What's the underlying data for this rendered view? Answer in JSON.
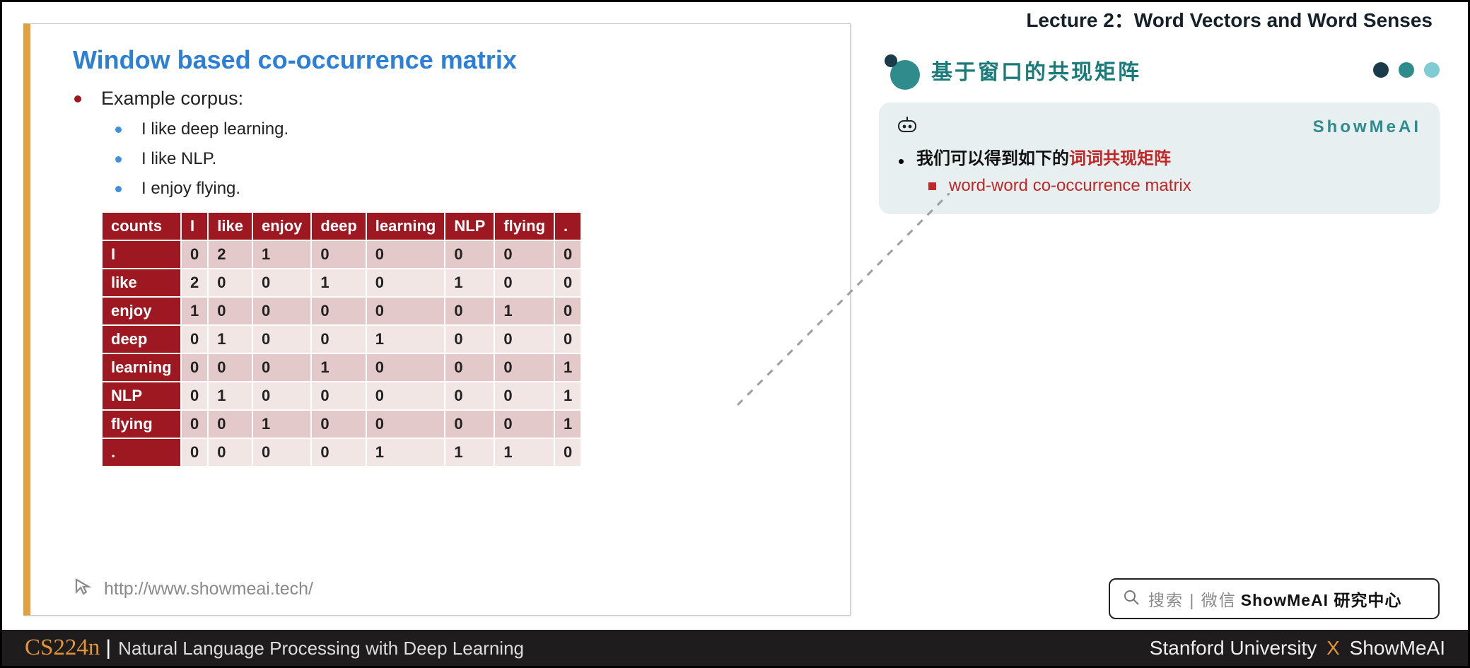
{
  "header": {
    "lecture_title": "Lecture 2：Word Vectors and Word Senses"
  },
  "slide": {
    "title": "Window based co-occurrence matrix",
    "bullet_main": "Example corpus:",
    "examples": [
      "I like deep learning.",
      "I like NLP.",
      "I enjoy flying."
    ],
    "footer_url": "http://www.showmeai.tech/"
  },
  "table": {
    "corner": "counts",
    "cols": [
      "I",
      "like",
      "enjoy",
      "deep",
      "learning",
      "NLP",
      "flying",
      "."
    ],
    "rows": [
      {
        "label": "I",
        "vals": [
          0,
          2,
          1,
          0,
          0,
          0,
          0,
          0
        ]
      },
      {
        "label": "like",
        "vals": [
          2,
          0,
          0,
          1,
          0,
          1,
          0,
          0
        ]
      },
      {
        "label": "enjoy",
        "vals": [
          1,
          0,
          0,
          0,
          0,
          0,
          1,
          0
        ]
      },
      {
        "label": "deep",
        "vals": [
          0,
          1,
          0,
          0,
          1,
          0,
          0,
          0
        ]
      },
      {
        "label": "learning",
        "vals": [
          0,
          0,
          0,
          1,
          0,
          0,
          0,
          1
        ]
      },
      {
        "label": "NLP",
        "vals": [
          0,
          1,
          0,
          0,
          0,
          0,
          0,
          1
        ]
      },
      {
        "label": "flying",
        "vals": [
          0,
          0,
          1,
          0,
          0,
          0,
          0,
          1
        ]
      },
      {
        "label": ".",
        "vals": [
          0,
          0,
          0,
          0,
          1,
          1,
          1,
          0
        ]
      }
    ]
  },
  "right": {
    "section_title": "基于窗口的共现矩阵",
    "brand": "ShowMeAI",
    "note_line1_a": "我们可以得到如下的",
    "note_line1_b": "词词共现矩阵",
    "note_line2": "word-word co-occurrence matrix"
  },
  "search": {
    "hint": "搜索 | 微信",
    "brand": "ShowMeAI 研究中心"
  },
  "footer": {
    "code": "CS224n",
    "course": "Natural Language Processing with Deep Learning",
    "right_a": "Stanford University",
    "right_b": "ShowMeAI"
  },
  "chart_data": {
    "type": "table",
    "title": "Window based co-occurrence matrix",
    "columns": [
      "counts",
      "I",
      "like",
      "enjoy",
      "deep",
      "learning",
      "NLP",
      "flying",
      "."
    ],
    "rows": [
      [
        "I",
        0,
        2,
        1,
        0,
        0,
        0,
        0,
        0
      ],
      [
        "like",
        2,
        0,
        0,
        1,
        0,
        1,
        0,
        0
      ],
      [
        "enjoy",
        1,
        0,
        0,
        0,
        0,
        0,
        1,
        0
      ],
      [
        "deep",
        0,
        1,
        0,
        0,
        1,
        0,
        0,
        0
      ],
      [
        "learning",
        0,
        0,
        0,
        1,
        0,
        0,
        0,
        1
      ],
      [
        "NLP",
        0,
        1,
        0,
        0,
        0,
        0,
        0,
        1
      ],
      [
        "flying",
        0,
        0,
        1,
        0,
        0,
        0,
        0,
        1
      ],
      [
        ".",
        0,
        0,
        0,
        0,
        1,
        1,
        1,
        0
      ]
    ]
  }
}
